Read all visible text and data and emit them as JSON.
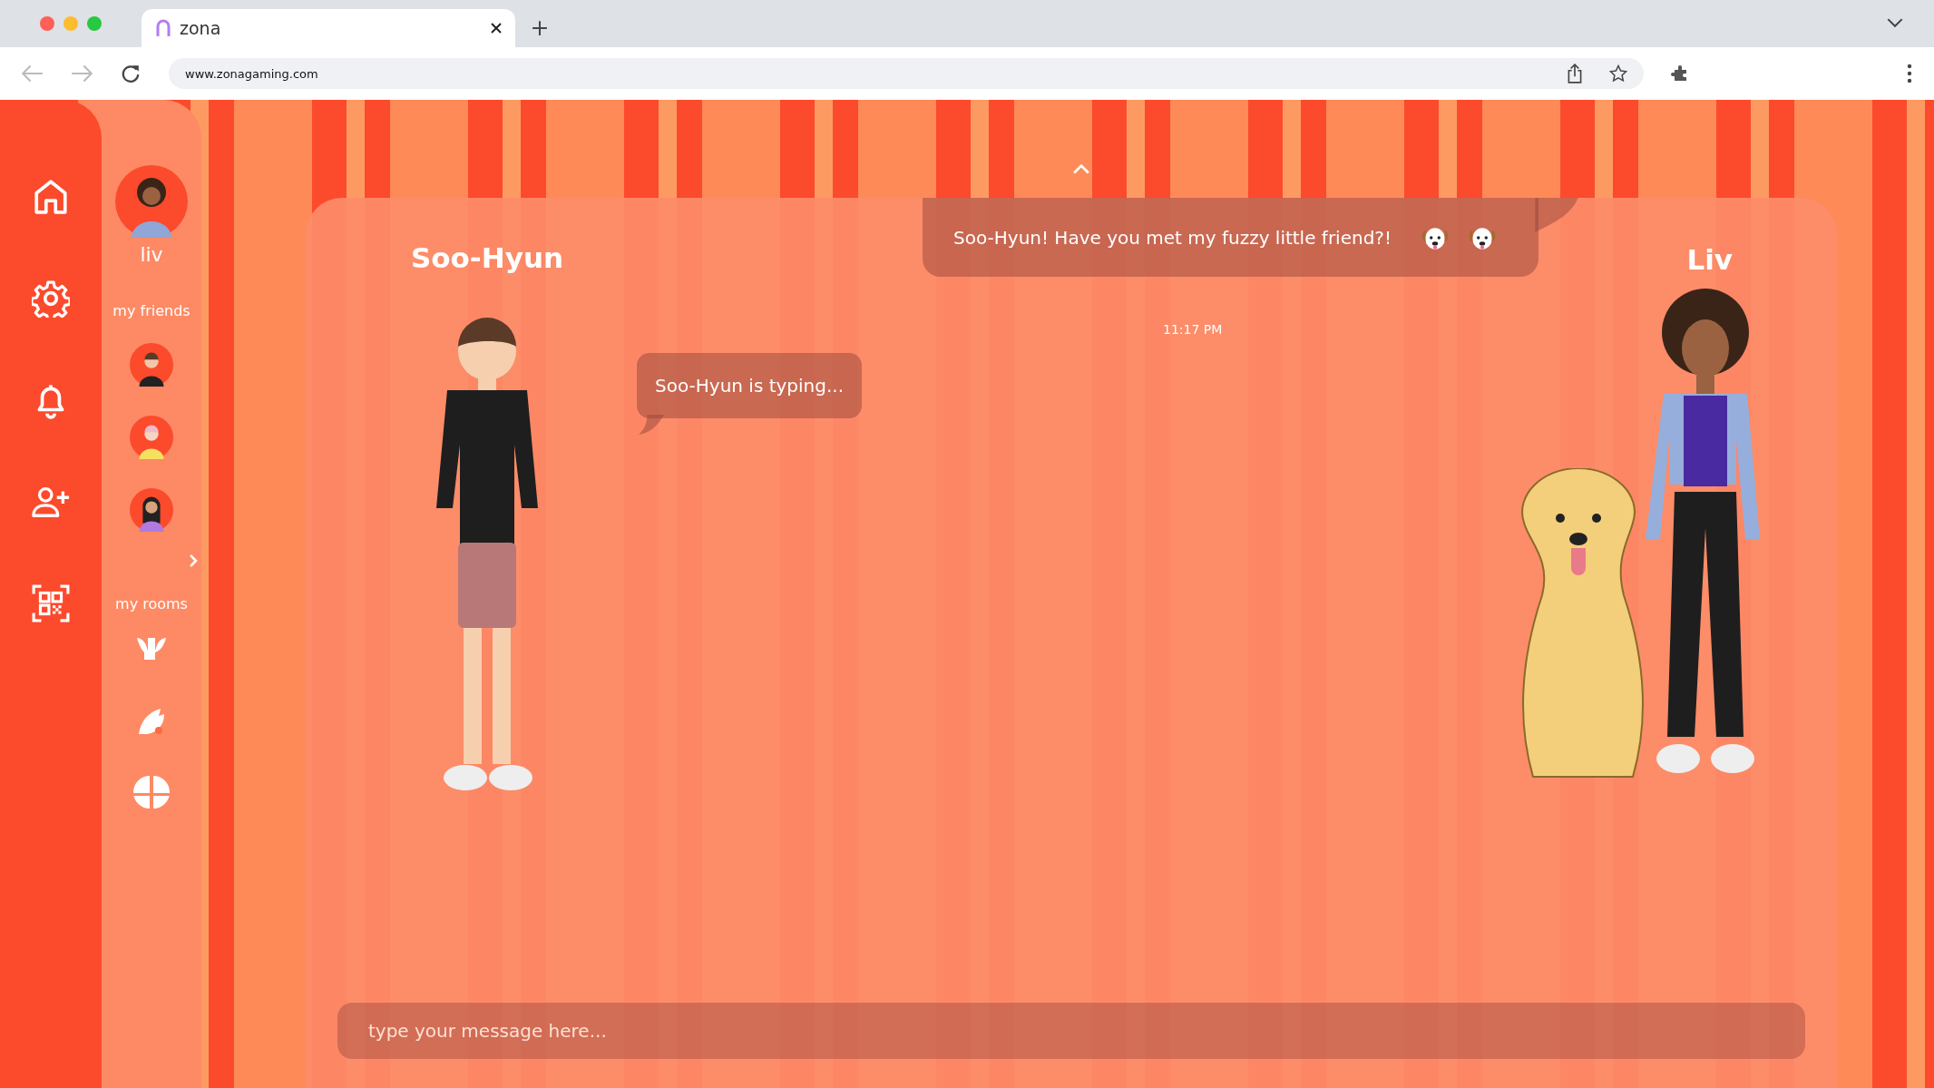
{
  "browser": {
    "tab": {
      "title": "zona",
      "selected": true
    },
    "url": "www.zonagaming.com"
  },
  "sidebar": {
    "user": {
      "name": "liv"
    },
    "friends_label": "my friends",
    "rooms_label": "my rooms"
  },
  "chat": {
    "partner": {
      "name": "Soo-Hyun"
    },
    "me": {
      "name": "Liv"
    },
    "messages": [
      {
        "kind": "sent",
        "text": "Soo-Hyun! Have you met my fuzzy little friend?!"
      },
      {
        "kind": "typing",
        "text": "Soo-Hyun is typing..."
      }
    ],
    "timestamp": "11:17 PM",
    "input": {
      "placeholder": "type your message here..."
    }
  }
}
